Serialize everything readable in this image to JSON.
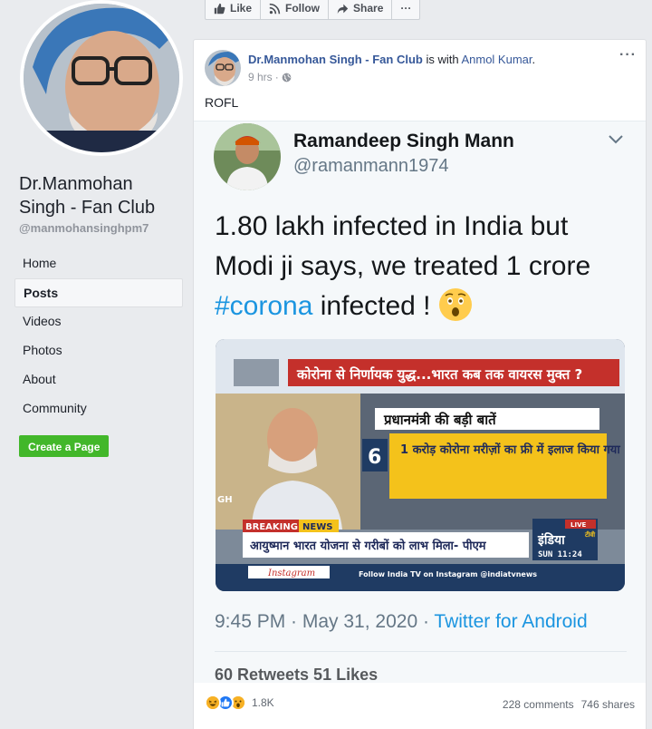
{
  "sidebar": {
    "page_name": "Dr.Manmohan Singh - Fan Club",
    "handle": "@manmohansinghpm7",
    "nav": [
      {
        "label": "Home"
      },
      {
        "label": "Posts"
      },
      {
        "label": "Videos"
      },
      {
        "label": "Photos"
      },
      {
        "label": "About"
      },
      {
        "label": "Community"
      }
    ],
    "create_page_label": "Create a Page"
  },
  "action_bar": {
    "like_label": "Like",
    "follow_label": "Follow",
    "share_label": "Share",
    "more_label": "···"
  },
  "post": {
    "author": "Dr.Manmohan Singh - Fan Club",
    "with_text": " is with ",
    "with_name": "Anmol Kumar",
    "with_suffix": ".",
    "time": "9 hrs",
    "dot": "·",
    "more": "···",
    "text": "ROFL",
    "tweet": {
      "name": "Ramandeep Singh Mann",
      "handle": "@ramanmann1974",
      "line1": "1.80 lakh infected in India but",
      "line2": "Modi ji says, we treated 1 crore",
      "hashtag": "#corona",
      "line3_rest": " infected ! ",
      "date": "9:45 PM · May 31, 2020 · ",
      "client": "Twitter for Android",
      "stats_partial": "60 Retweets   51 Likes",
      "news": {
        "headline": "कोरोना से निर्णायक युद्ध...भारत कब तक वायरस मुक्त ?",
        "panel_title": "प्रधानमंत्री की बड़ी बातें",
        "number": "6",
        "point": "1 करोड़ कोरोना मरीज़ों का फ्री में इलाज किया गया",
        "gh": "GH",
        "breaking": "BREAKING",
        "news_word": "NEWS",
        "ticker": "आयुष्मान भारत योजना से गरीबों को लाभ मिला- पीएम",
        "channel": "इंडिया",
        "channel_tv": "टीवी",
        "live": "LIVE",
        "clock": "SUN  11:24",
        "instagram": "Instagram",
        "follow_text": "Follow India TV on Instagram @indiatvnews"
      }
    }
  },
  "footer": {
    "reaction_count": "1.8K",
    "comments": "228 comments",
    "shares": "746 shares"
  },
  "colors": {
    "link": "#365899",
    "twitter_blue": "#1b95e0",
    "fb_green": "#42b72a"
  }
}
